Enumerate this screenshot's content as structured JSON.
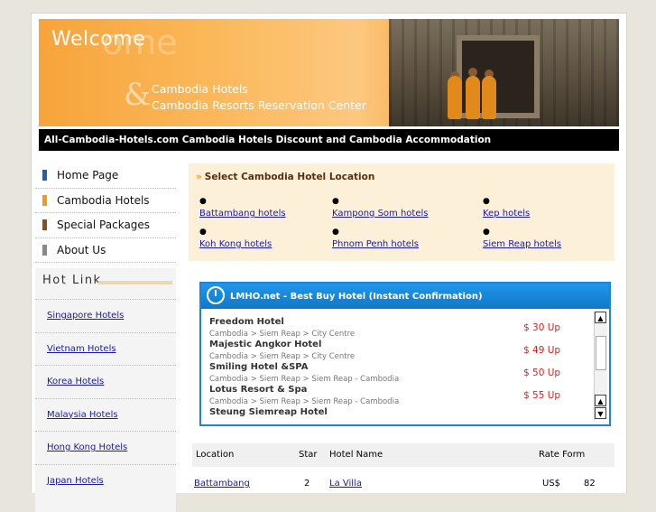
{
  "banner": {
    "welcome": "Welcome",
    "welcome_ghost": "ome",
    "ampersand": "&",
    "tagline1": "Cambodia Hotels",
    "tagline2": "Cambodia Resorts Reservation Center"
  },
  "titlebar": "All-Cambodia-Hotels.com Cambodia Hotels Discount and Cambodia Accommodation",
  "nav": {
    "items": [
      {
        "label": "Home Page",
        "color": "#1d5fb5"
      },
      {
        "label": "Cambodia Hotels",
        "color": "#f39a1e"
      },
      {
        "label": "Special Packages",
        "color": "#8a4d1c"
      },
      {
        "label": "About Us",
        "color": "#888888"
      }
    ]
  },
  "hotlink": {
    "title": "Hot Link",
    "items": [
      "Singapore Hotels",
      "Vietnam Hotels",
      "Korea Hotels",
      "Malaysia Hotels",
      "Hong Kong Hotels",
      "Japan Hotels"
    ]
  },
  "location": {
    "title": "Select Cambodia Hotel Location",
    "links": [
      "Battambang hotels",
      "Kampong Som hotels",
      "Kep hotels",
      "Koh Kong hotels",
      "Phnom Penh hotels",
      "Siem Reap hotels"
    ]
  },
  "widget": {
    "title": "LMHO.net - Best Buy Hotel (Instant Confirmation)",
    "hotels": [
      {
        "name": "Freedom Hotel",
        "path": "Cambodia > Siem Reap > City Centre",
        "price": "$ 30 Up"
      },
      {
        "name": "Majestic Angkor Hotel",
        "path": "Cambodia > Siem Reap > City Centre",
        "price": "$ 49 Up"
      },
      {
        "name": "Smiling Hotel &SPA",
        "path": "Cambodia > Siem Reap > Siem Reap - Cambodia",
        "price": "$ 50 Up"
      },
      {
        "name": "Lotus Resort & Spa",
        "path": "Cambodia > Siem Reap > Siem Reap - Cambodia",
        "price": "$ 55 Up"
      },
      {
        "name": "Steung Siemreap Hotel",
        "path": "",
        "price": ""
      }
    ]
  },
  "table": {
    "headers": [
      "Location",
      "Star",
      "Hotel Name",
      "Rate Form"
    ],
    "rows": [
      {
        "location": "Battambang",
        "star": "2",
        "hotel": "La Villa",
        "currency": "US$",
        "rate": "82"
      }
    ]
  }
}
